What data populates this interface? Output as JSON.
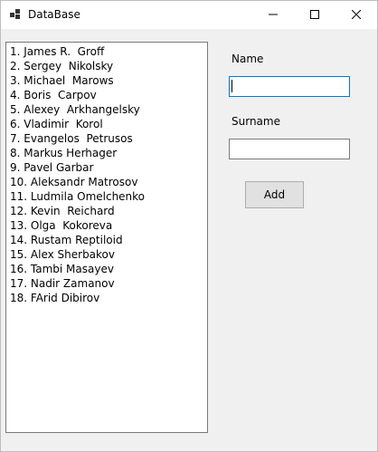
{
  "window": {
    "title": "DataBase"
  },
  "list": {
    "items": [
      "1. James R.  Groff",
      "2. Sergey  Nikolsky",
      "3. Michael  Marows",
      "4. Boris  Carpov",
      "5. Alexey  Arkhangelsky",
      "6. Vladimir  Korol",
      "7. Evangelos  Petrusos",
      "8. Markus Herhager",
      "9. Pavel Garbar",
      "10. Aleksandr Matrosov",
      "11. Ludmila Omelchenko",
      "12. Kevin  Reichard",
      "13. Olga  Kokoreva",
      "14. Rustam Reptiloid",
      "15. Alex Sherbakov",
      "16. Tambi Masayev",
      "17. Nadir Zamanov",
      "18. FArid Dibirov"
    ]
  },
  "form": {
    "name_label": "Name",
    "name_value": "",
    "surname_label": "Surname",
    "surname_value": "",
    "add_label": "Add"
  },
  "icons": {
    "app": "database-app-icon",
    "minimize": "minimize-icon",
    "maximize": "maximize-icon",
    "close": "close-icon"
  }
}
